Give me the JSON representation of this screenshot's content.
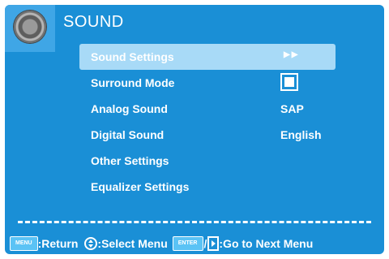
{
  "header": {
    "title": "SOUND",
    "icon": "speaker-icon"
  },
  "menu": {
    "items": [
      {
        "label": "Sound Settings",
        "value": "",
        "control": "arrows",
        "selected": true
      },
      {
        "label": "Surround Mode",
        "value": "",
        "control": "checkbox",
        "checked": true
      },
      {
        "label": "Analog Sound",
        "value": "SAP"
      },
      {
        "label": "Digital Sound",
        "value": "English"
      },
      {
        "label": "Other Settings",
        "value": ""
      },
      {
        "label": "Equalizer Settings",
        "value": ""
      }
    ],
    "arrows_glyph": "▶▶"
  },
  "footer": {
    "menu_key": "MENU",
    "return_label": ":Return",
    "select_label": ":Select Menu",
    "enter_key": "ENTER",
    "slash": "/",
    "next_label": ":Go to Next Menu"
  },
  "colors": {
    "background": "#1a8fd6",
    "highlight": "#a8daf7",
    "key": "#5bc3f5",
    "text": "#ffffff"
  }
}
